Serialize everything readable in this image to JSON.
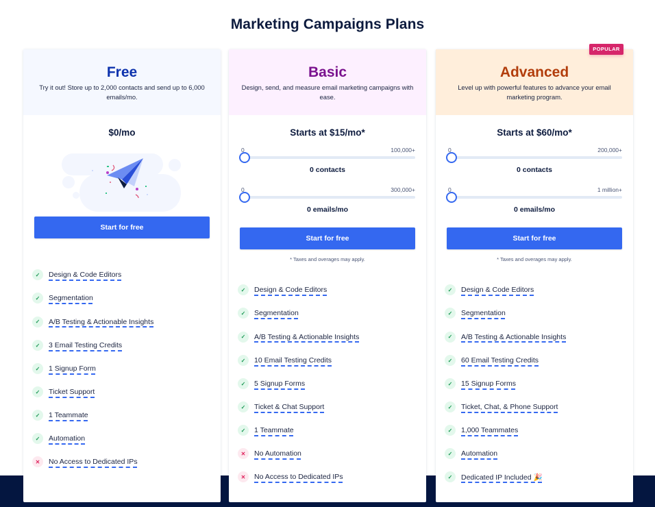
{
  "page": {
    "title": "Marketing Campaigns Plans"
  },
  "colors": {
    "accent": "#3468f0",
    "dark_band": "#041640",
    "free_name": "#0d32ad",
    "basic_name": "#7a128e",
    "advanced_name": "#b23d0c",
    "free_header_bg": "#f5f8ff",
    "basic_header_bg": "#fdf0ff",
    "advanced_header_bg": "#ffeedb",
    "popular_badge": "#d6266a",
    "check_green": "#1e9a56",
    "cross_red": "#e0245e"
  },
  "plans": {
    "free": {
      "name": "Free",
      "description": "Try it out! Store up to 2,000 contacts and send up to 6,000 emails/mo.",
      "price": "$0/mo",
      "illustration": "paper-plane-illustration",
      "cta": "Start for free",
      "features": [
        {
          "label": "Design & Code Editors",
          "included": true,
          "icon": "check-icon"
        },
        {
          "label": "Segmentation",
          "included": true,
          "icon": "check-icon"
        },
        {
          "label": "A/B Testing & Actionable Insights",
          "included": true,
          "icon": "check-icon"
        },
        {
          "label": "3 Email Testing Credits",
          "included": true,
          "icon": "check-icon"
        },
        {
          "label": "1 Signup Form",
          "included": true,
          "icon": "check-icon"
        },
        {
          "label": "Ticket Support",
          "included": true,
          "icon": "check-icon"
        },
        {
          "label": "1 Teammate",
          "included": true,
          "icon": "check-icon"
        },
        {
          "label": "Automation",
          "included": true,
          "icon": "check-icon"
        },
        {
          "label": "No Access to Dedicated IPs",
          "included": false,
          "icon": "cross-icon"
        }
      ]
    },
    "basic": {
      "name": "Basic",
      "description": "Design, send, and measure email marketing campaigns with ease.",
      "price": "Starts at $15/mo*",
      "contacts_slider": {
        "min_label": "0",
        "max_label": "100,000+",
        "value": 0,
        "value_label": "0 contacts"
      },
      "emails_slider": {
        "min_label": "0",
        "max_label": "300,000+",
        "value": 0,
        "value_label": "0 emails/mo"
      },
      "cta": "Start for free",
      "tax_note": "* Taxes and overages may apply.",
      "features": [
        {
          "label": "Design & Code Editors",
          "included": true,
          "icon": "check-icon"
        },
        {
          "label": "Segmentation",
          "included": true,
          "icon": "check-icon"
        },
        {
          "label": "A/B Testing & Actionable Insights",
          "included": true,
          "icon": "check-icon"
        },
        {
          "label": "10 Email Testing Credits",
          "included": true,
          "icon": "check-icon"
        },
        {
          "label": "5 Signup Forms",
          "included": true,
          "icon": "check-icon"
        },
        {
          "label": "Ticket & Chat Support",
          "included": true,
          "icon": "check-icon"
        },
        {
          "label": "1 Teammate",
          "included": true,
          "icon": "check-icon"
        },
        {
          "label": "No Automation",
          "included": false,
          "icon": "cross-icon"
        },
        {
          "label": "No Access to Dedicated IPs",
          "included": false,
          "icon": "cross-icon"
        }
      ]
    },
    "advanced": {
      "name": "Advanced",
      "badge": "POPULAR",
      "description": "Level up with powerful features to advance your email marketing program.",
      "price": "Starts at $60/mo*",
      "contacts_slider": {
        "min_label": "0",
        "max_label": "200,000+",
        "value": 0,
        "value_label": "0 contacts"
      },
      "emails_slider": {
        "min_label": "0",
        "max_label": "1 million+",
        "value": 0,
        "value_label": "0 emails/mo"
      },
      "cta": "Start for free",
      "tax_note": "* Taxes and overages may apply.",
      "features": [
        {
          "label": "Design & Code Editors",
          "included": true,
          "icon": "check-icon"
        },
        {
          "label": "Segmentation",
          "included": true,
          "icon": "check-icon"
        },
        {
          "label": "A/B Testing & Actionable Insights",
          "included": true,
          "icon": "check-icon"
        },
        {
          "label": "60 Email Testing Credits",
          "included": true,
          "icon": "check-icon"
        },
        {
          "label": "15 Signup Forms",
          "included": true,
          "icon": "check-icon"
        },
        {
          "label": "Ticket, Chat, & Phone Support",
          "included": true,
          "icon": "check-icon"
        },
        {
          "label": "1,000 Teammates",
          "included": true,
          "icon": "check-icon"
        },
        {
          "label": "Automation",
          "included": true,
          "icon": "check-icon"
        },
        {
          "label": "Dedicated IP Included 🎉",
          "included": true,
          "icon": "check-icon"
        }
      ]
    }
  },
  "icons": {
    "check": "✓",
    "cross": "✕"
  }
}
